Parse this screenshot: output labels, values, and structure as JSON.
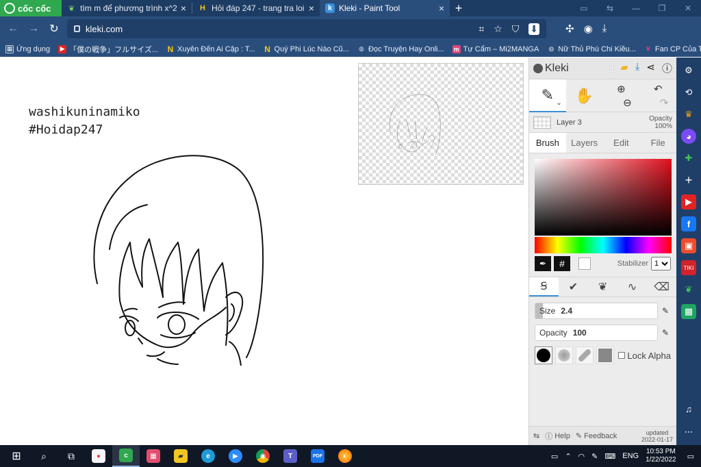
{
  "browser": {
    "brand": "cốc cốc",
    "tabs": [
      {
        "title": "tìm m để phương trình x^2+",
        "favicon": "leaf-icon",
        "active": false
      },
      {
        "title": "Hỏi đáp 247 - trang tra loi",
        "favicon": "h-icon",
        "active": false
      },
      {
        "title": "Kleki - Paint Tool",
        "favicon": "kleki-icon",
        "active": true
      }
    ],
    "url": "kleki.com",
    "bookmarks": [
      {
        "label": "Ứng dụng",
        "icon": "apps-grid-icon"
      },
      {
        "label": "「僕の戦争」フルサイズ...",
        "icon": "youtube-icon"
      },
      {
        "label": "Xuyên Đến Ai Cập : T...",
        "icon": "n-icon"
      },
      {
        "label": "Quý Phi Lúc Nào Cũ...",
        "icon": "n-icon"
      },
      {
        "label": "Đọc Truyện Hay Onli...",
        "icon": "globe-icon"
      },
      {
        "label": "Tự Cẩm – Mi2MANGA",
        "icon": "manga-icon"
      },
      {
        "label": "Nữ Thủ Phú Chi Kiều...",
        "icon": "globe-icon"
      },
      {
        "label": "Fan CP Của Tôi Và Á...",
        "icon": "crown-icon"
      }
    ]
  },
  "canvas": {
    "line1": "washikuninamiko",
    "line2": "#Hoidap247"
  },
  "kleki": {
    "logo": "Kleki",
    "layer_name": "Layer 3",
    "layer_opacity_label": "Opacity",
    "layer_opacity_value": "100%",
    "tabs": [
      "Brush",
      "Layers",
      "Edit",
      "File"
    ],
    "hex_label": "#",
    "stabilizer_label": "Stabilizer",
    "stabilizer_value": "1",
    "size_label": "Size",
    "size_value": "2.4",
    "size_fraction": 0.06,
    "opacity_label": "Opacity",
    "opacity_value": "100",
    "opacity_fraction": 1.0,
    "lock_alpha_label": "Lock Alpha",
    "help_label": "Help",
    "feedback_label": "Feedback",
    "updated_label": "updated",
    "updated_date": "2022-01-17"
  },
  "taskbar": {
    "lang": "ENG",
    "time": "10:53 PM",
    "date": "1/22/2022"
  },
  "colors": {
    "brand_green": "#2fa84f",
    "tabbar": "#1d3c63",
    "toolbar": "#2a4e7c",
    "accent_blue": "#3a8fd8"
  }
}
